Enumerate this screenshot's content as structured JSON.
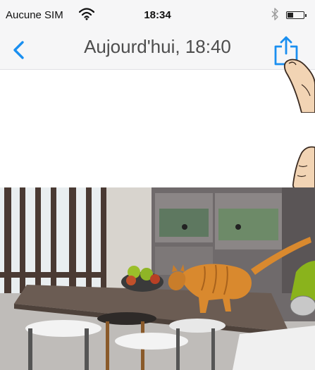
{
  "status_bar": {
    "carrier": "Aucune SIM",
    "time": "18:34",
    "wifi_icon": "wifi-icon",
    "bluetooth_icon": "bluetooth-icon",
    "battery_icon": "battery-icon",
    "battery_level": 0.35
  },
  "nav": {
    "back_icon": "chevron-left-icon",
    "title": "Aujourd'hui, 18:40",
    "share_icon": "share-icon"
  },
  "colors": {
    "accent": "#1a8ff0",
    "bar_background": "#f6f6f7",
    "title": "#4d4d4d"
  }
}
